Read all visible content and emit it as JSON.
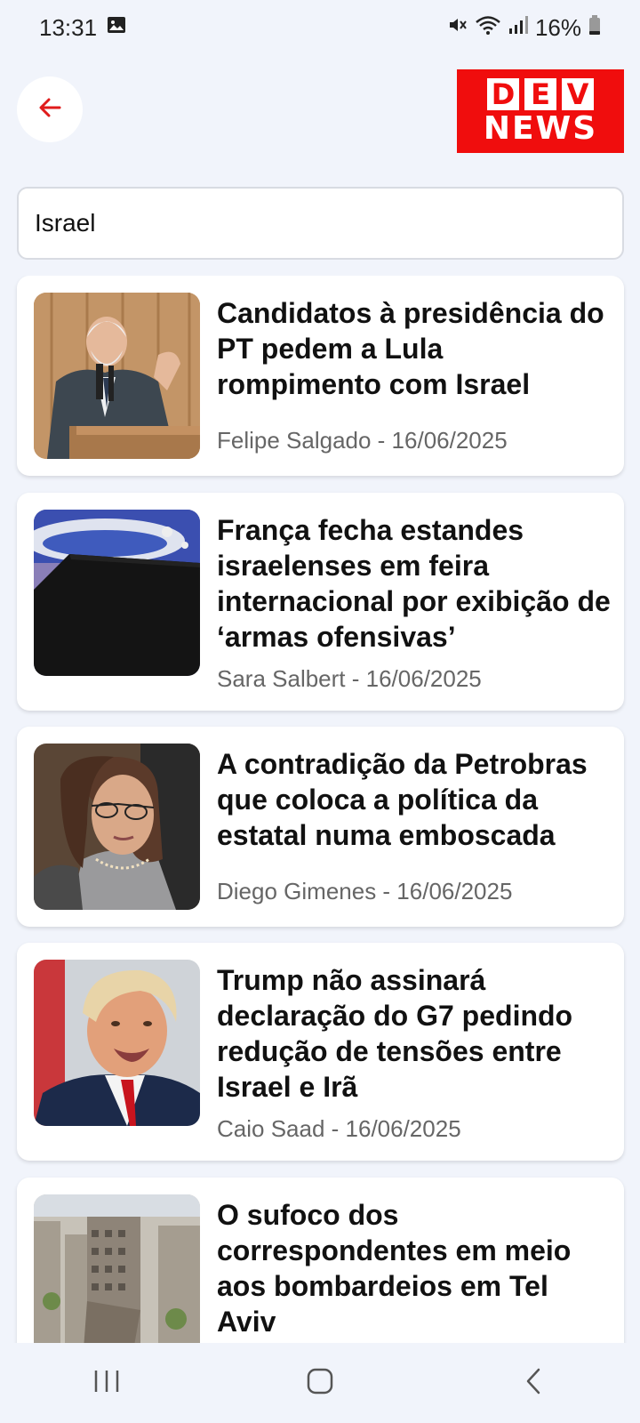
{
  "status_bar": {
    "time": "13:31",
    "battery": "16%"
  },
  "header": {
    "logo_line1": [
      "D",
      "E",
      "V"
    ],
    "logo_line2": "NEWS",
    "brand_color": "#f00d0d"
  },
  "search": {
    "value": "Israel"
  },
  "articles": [
    {
      "title": "Candidatos à presidência do PT pedem a Lula rompimento com Israel",
      "meta": "Felipe Salgado - 16/06/2025"
    },
    {
      "title": "França fecha estandes israelenses em feira internacional por exibição de ‘armas ofensivas’",
      "meta": "Sara Salbert - 16/06/2025"
    },
    {
      "title": "A contradição da Petrobras que coloca a política da estatal numa emboscada",
      "meta": "Diego Gimenes - 16/06/2025"
    },
    {
      "title": "Trump não assinará declaração do G7 pedindo redução de tensões entre Israel e Irã",
      "meta": "Caio Saad - 16/06/2025"
    },
    {
      "title": "O sufoco dos correspondentes em meio aos bombardeios em Tel Aviv",
      "meta": ""
    }
  ]
}
